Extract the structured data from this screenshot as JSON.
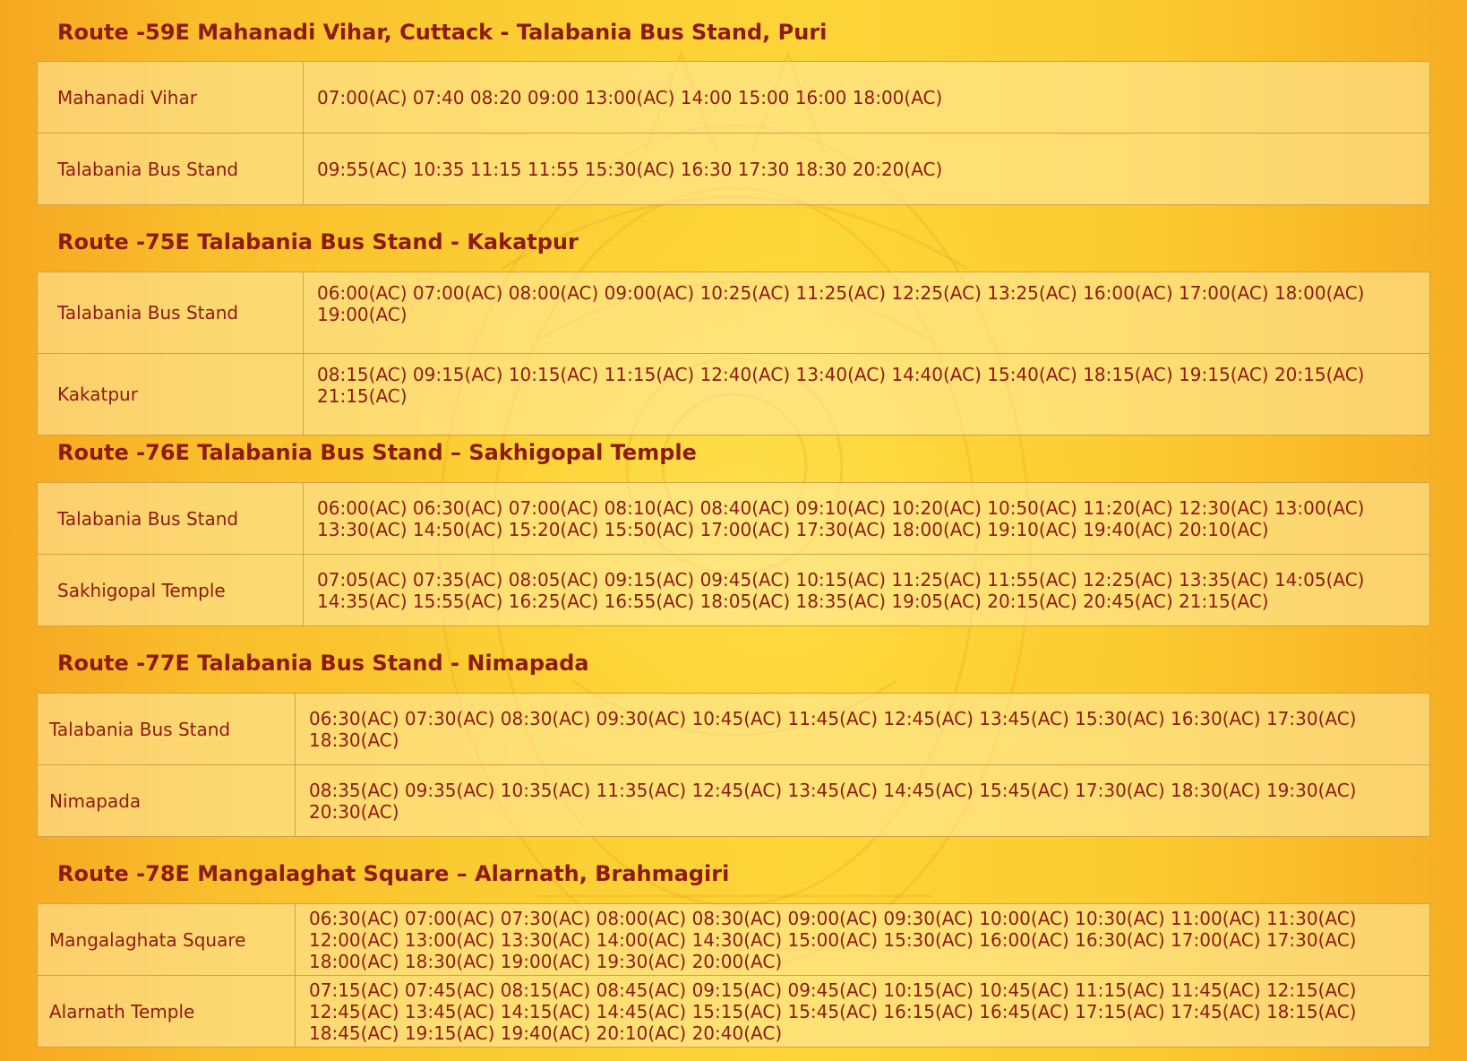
{
  "routes": [
    {
      "title": "Route -59E Mahanadi Vihar, Cuttack - Talabania Bus Stand, Puri",
      "rows": [
        {
          "stop": "Mahanadi Vihar",
          "times": "07:00(AC) 07:40 08:20 09:00 13:00(AC) 14:00 15:00 16:00 18:00(AC)"
        },
        {
          "stop": "Talabania Bus Stand",
          "times": "09:55(AC) 10:35 11:15 11:55 15:30(AC) 16:30 17:30 18:30 20:20(AC)"
        }
      ]
    },
    {
      "title": "Route -75E Talabania Bus Stand - Kakatpur",
      "rows": [
        {
          "stop": "Talabania Bus Stand",
          "times": "06:00(AC) 07:00(AC) 08:00(AC) 09:00(AC) 10:25(AC) 11:25(AC) 12:25(AC) 13:25(AC) 16:00(AC) 17:00(AC) 18:00(AC) 19:00(AC)"
        },
        {
          "stop": "Kakatpur",
          "times": "08:15(AC) 09:15(AC) 10:15(AC) 11:15(AC) 12:40(AC) 13:40(AC) 14:40(AC) 15:40(AC) 18:15(AC) 19:15(AC) 20:15(AC) 21:15(AC)"
        }
      ]
    },
    {
      "title": "Route -76E Talabania Bus Stand – Sakhigopal Temple",
      "rows": [
        {
          "stop": "Talabania Bus Stand",
          "times": "06:00(AC) 06:30(AC) 07:00(AC) 08:10(AC) 08:40(AC) 09:10(AC) 10:20(AC) 10:50(AC) 11:20(AC) 12:30(AC) 13:00(AC) 13:30(AC) 14:50(AC) 15:20(AC) 15:50(AC) 17:00(AC) 17:30(AC) 18:00(AC) 19:10(AC) 19:40(AC) 20:10(AC)"
        },
        {
          "stop": "Sakhigopal Temple",
          "times": "07:05(AC) 07:35(AC) 08:05(AC) 09:15(AC) 09:45(AC) 10:15(AC) 11:25(AC) 11:55(AC) 12:25(AC) 13:35(AC) 14:05(AC) 14:35(AC) 15:55(AC) 16:25(AC) 16:55(AC) 18:05(AC) 18:35(AC) 19:05(AC) 20:15(AC) 20:45(AC) 21:15(AC)"
        }
      ]
    },
    {
      "title": "Route -77E Talabania Bus Stand - Nimapada",
      "rows": [
        {
          "stop": "Talabania Bus Stand",
          "times": "06:30(AC) 07:30(AC) 08:30(AC) 09:30(AC) 10:45(AC) 11:45(AC) 12:45(AC) 13:45(AC) 15:30(AC) 16:30(AC) 17:30(AC) 18:30(AC)"
        },
        {
          "stop": "Nimapada",
          "times": "08:35(AC) 09:35(AC) 10:35(AC) 11:35(AC) 12:45(AC) 13:45(AC) 14:45(AC) 15:45(AC) 17:30(AC) 18:30(AC) 19:30(AC) 20:30(AC)"
        }
      ]
    },
    {
      "title": "Route -78E Mangalaghat Square – Alarnath, Brahmagiri",
      "rows": [
        {
          "stop": "Mangalaghata Square",
          "times": "06:30(AC) 07:00(AC) 07:30(AC) 08:00(AC) 08:30(AC) 09:00(AC) 09:30(AC) 10:00(AC) 10:30(AC) 11:00(AC) 11:30(AC) 12:00(AC) 13:00(AC) 13:30(AC) 14:00(AC) 14:30(AC) 15:00(AC) 15:30(AC) 16:00(AC) 16:30(AC) 17:00(AC) 17:30(AC) 18:00(AC) 18:30(AC) 19:00(AC) 19:30(AC) 20:00(AC)"
        },
        {
          "stop": "Alarnath Temple",
          "times": "07:15(AC) 07:45(AC) 08:15(AC) 08:45(AC) 09:15(AC) 09:45(AC) 10:15(AC) 10:45(AC) 11:15(AC) 11:45(AC) 12:15(AC) 12:45(AC) 13:45(AC) 14:15(AC) 14:45(AC) 15:15(AC) 15:45(AC) 16:15(AC) 16:45(AC) 17:15(AC) 17:45(AC) 18:15(AC) 18:45(AC) 19:15(AC) 19:40(AC) 20:10(AC) 20:40(AC)"
        }
      ]
    }
  ]
}
